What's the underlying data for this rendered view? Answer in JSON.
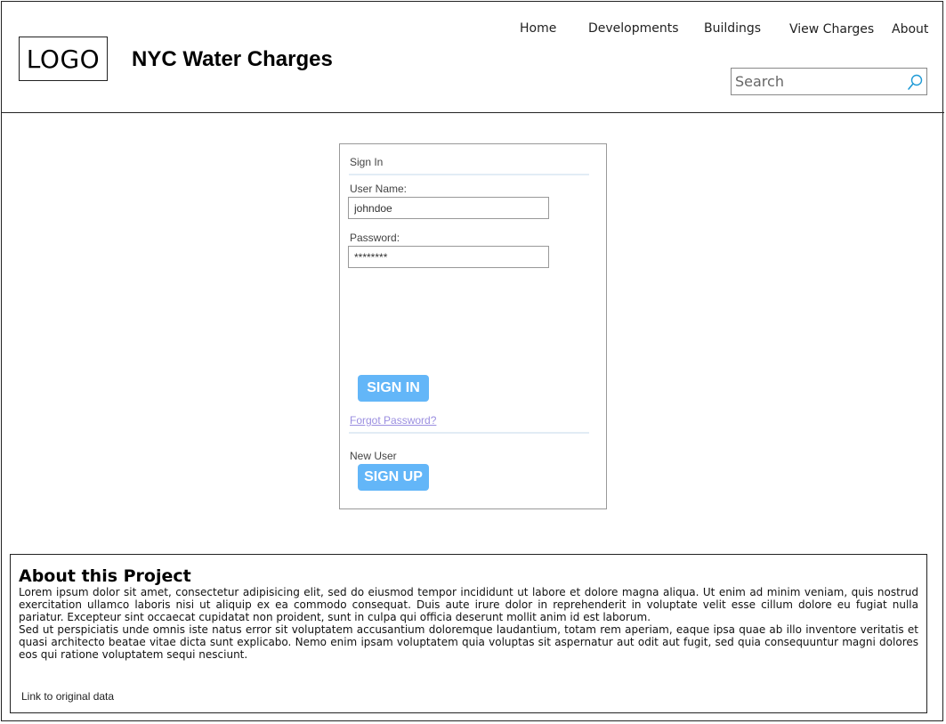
{
  "header": {
    "logo_text": "LOGO",
    "title": "NYC Water Charges",
    "nav": [
      "Home",
      "Developments",
      "Buildings",
      "View Charges",
      "About"
    ],
    "search_placeholder": "Search"
  },
  "sign_in": {
    "heading": "Sign In",
    "username_label": "User Name:",
    "username_value": "johndoe",
    "password_label": "Password:",
    "password_value": "********",
    "sign_in_button": "SIGN IN",
    "forgot_link": "Forgot Password?",
    "new_user_label": "New User",
    "sign_up_button": "SIGN UP"
  },
  "about": {
    "heading": "About this Project",
    "paragraph1": "Lorem ipsum dolor sit amet, consectetur adipisicing elit, sed do eiusmod tempor incididunt ut labore et dolore magna aliqua. Ut enim ad minim veniam, quis nostrud exercitation ullamco laboris nisi ut aliquip ex ea commodo consequat. Duis aute irure dolor in reprehenderit in voluptate velit esse cillum dolore eu fugiat nulla pariatur. Excepteur sint occaecat cupidatat non proident, sunt in culpa qui officia deserunt mollit anim id est laborum.",
    "paragraph2": "Sed ut perspiciatis unde omnis iste natus error sit voluptatem accusantium doloremque laudantium, totam rem aperiam, eaque ipsa quae ab illo inventore veritatis et quasi architecto beatae vitae dicta sunt explicabo. Nemo enim ipsam voluptatem quia voluptas sit aspernatur aut odit aut fugit, sed quia consequuntur magni dolores eos qui ratione voluptatem sequi nesciunt.",
    "data_link": "Link to original data"
  },
  "colors": {
    "button": "#63b6f8",
    "link": "#9b8fe0",
    "search_icon": "#1e9ad6"
  }
}
